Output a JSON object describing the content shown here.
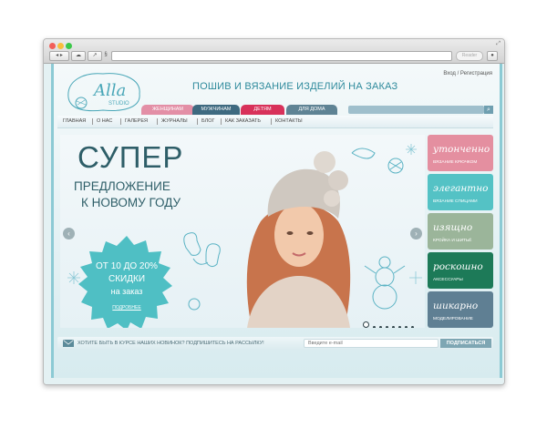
{
  "browser": {
    "reader_label": "Reader"
  },
  "site": {
    "logo_text": "Alla",
    "logo_sub": "STUDIO",
    "headline": "ПОШИВ И ВЯЗАНИЕ ИЗДЕЛИЙ НА ЗАКАЗ",
    "login": "Вход / Регистрация"
  },
  "tabs": [
    {
      "label": "ЖЕНЩИНАМ",
      "color": "#e38fa6"
    },
    {
      "label": "МУЖЧИНАМ",
      "color": "#3e6a80"
    },
    {
      "label": "ДЕТЯМ",
      "color": "#d8315a"
    },
    {
      "label": "ДЛЯ ДОМА",
      "color": "#5f8394"
    }
  ],
  "nav": [
    "ГЛАВНАЯ",
    "О НАС",
    "ГАЛЕРЕЯ",
    "ЖУРНАЛЫ",
    "БЛОГ",
    "КАК ЗАКАЗАТЬ",
    "КОНТАКТЫ"
  ],
  "banner": {
    "title": "СУПЕР",
    "line1": "ПРЕДЛОЖЕНИЕ",
    "line2": "К НОВОМУ ГОДУ",
    "discount_l1": "ОТ 10 ДО 20%",
    "discount_l2": "СКИДКИ",
    "discount_l3": "на заказ",
    "more": "ПОДРОБНЕЕ",
    "slide_count": 8,
    "active_slide": 1
  },
  "categories": [
    {
      "title": "утонченно",
      "sub": "ВЯЗАНИЕ КРЮЧКОМ",
      "color": "#e48fa0"
    },
    {
      "title": "элегантно",
      "sub": "ВЯЗАНИЕ СПИЦАМИ",
      "color": "#54c2c5"
    },
    {
      "title": "изящно",
      "sub": "КРОЙКА И ШИТЬЁ",
      "color": "#9bb59a"
    },
    {
      "title": "роскошно",
      "sub": "АКСЕССУАРЫ",
      "color": "#1d7a58"
    },
    {
      "title": "шикарно",
      "sub": "МОДЕЛИРОВАНИЕ",
      "color": "#5f7f93"
    }
  ],
  "subscribe": {
    "text": "ХОТИТЕ БЫТЬ В КУРСЕ НАШИХ НОВИНОК?  ПОДПИШИТЕСЬ НА РАССЫЛКУ!",
    "email_placeholder": "Введите e-mail",
    "button": "ПОДПИСАТЬСЯ"
  }
}
